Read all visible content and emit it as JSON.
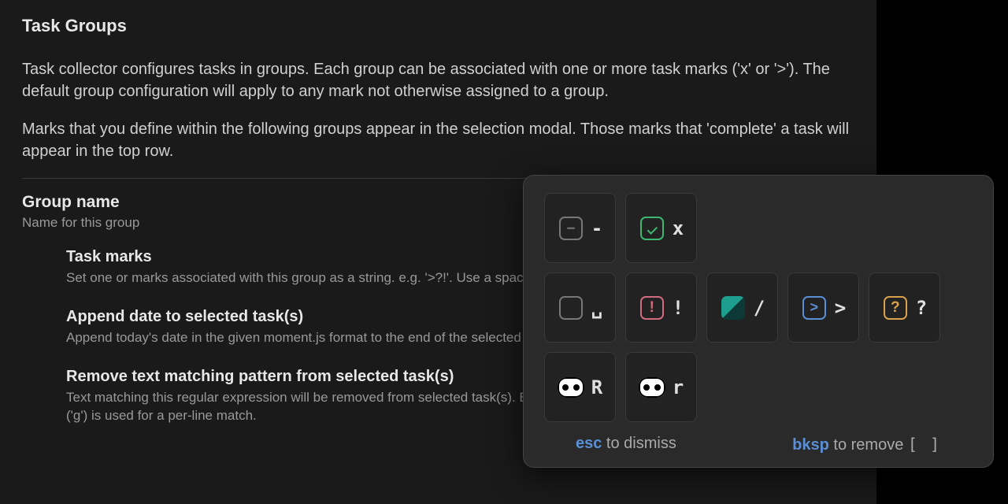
{
  "section": {
    "title": "Task Groups",
    "intro1": "Task collector configures tasks in groups. Each group can be associated with one or more task marks ('x' or '>'). The default group configuration will apply to any mark not otherwise assigned to a group.",
    "intro2": "Marks that you define within the following groups appear in the selection modal. Those marks that 'complete' a task will appear in the top row."
  },
  "group_name": {
    "title": "Group name",
    "desc": "Name for this group"
  },
  "sub": {
    "task_marks": {
      "title": "Task marks",
      "desc": "Set one or marks associated with this group as a string. e.g. '>?!'. Use a space to match unmarked tasks."
    },
    "append_date": {
      "title": "Append date to selected task(s)",
      "desc": "Append today's date in the given moment.js format to the end of the selected task text."
    },
    "remove_text": {
      "title": "Remove text matching pattern from selected task(s)",
      "desc": "Text matching this regular expression will be removed from selected task(s). Be careful! Test your expression first. The global flag ('g') is used for a per-line match."
    }
  },
  "modal": {
    "marks": {
      "row1": [
        {
          "name": "minus",
          "icon": "box-minus",
          "char": "-"
        },
        {
          "name": "x",
          "icon": "check",
          "char": "x"
        }
      ],
      "row2": [
        {
          "name": "space",
          "icon": "box",
          "char": "␣"
        },
        {
          "name": "exclaim",
          "icon": "exclaim",
          "char": "!"
        },
        {
          "name": "slash",
          "icon": "slash",
          "char": "/"
        },
        {
          "name": "gt",
          "icon": "chevron",
          "char": ">"
        },
        {
          "name": "question",
          "icon": "question",
          "char": "?"
        }
      ],
      "row3": [
        {
          "name": "R",
          "icon": "eyes",
          "char": "R"
        },
        {
          "name": "r",
          "icon": "eyes",
          "char": "r"
        }
      ]
    },
    "footer": {
      "esc_key": "esc",
      "esc_text": " to dismiss",
      "bksp_key": "bksp",
      "bksp_text": " to remove ",
      "brackets": "[ ]"
    }
  }
}
